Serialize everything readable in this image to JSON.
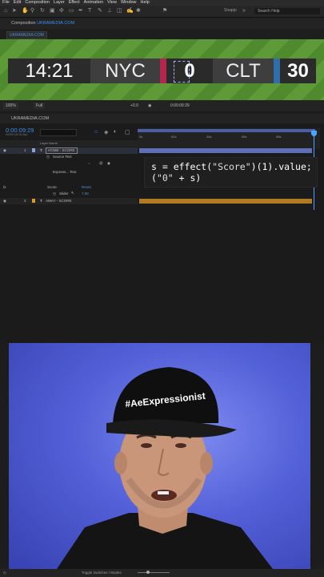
{
  "menu": [
    "File",
    "Edit",
    "Composition",
    "Layer",
    "Effect",
    "Animation",
    "View",
    "Window",
    "Help"
  ],
  "toolbar": {
    "snapping": "Snappi",
    "search_placeholder": "Search Help"
  },
  "composition_tab": {
    "prefix": "Composition",
    "name": "UKRAMEDIA.COM"
  },
  "comp_chip": "UKRAMEDIA.COM",
  "scoreboard": {
    "time": "14:21",
    "home_team": "NYC",
    "home_score": "0",
    "away_team": "CLT",
    "away_score": "30",
    "home_color": "#b5264e",
    "away_color": "#2f6ea8"
  },
  "viewer_controls": {
    "zoom": "100%",
    "resolution": "Full",
    "offset": "+0.0",
    "timecode": "0:00:09:29"
  },
  "timeline": {
    "tab": "UKRAMEDIA.COM",
    "timecode": "0:00:09:29",
    "timecode_sub": "00299 (30.00 fps)",
    "layer_name_header": "Layer Name",
    "ticks": [
      "0s",
      "02s",
      "04s",
      "06s",
      "08s"
    ],
    "layers": [
      {
        "num": "1",
        "name": "HOME - SCORE"
      },
      {
        "num": "2",
        "name": "AWAY - SCORE"
      }
    ],
    "source_text": "Source Text",
    "express_text": "Express... Text",
    "effect": "Score",
    "reset": "Reset",
    "slider": "Slider",
    "slider_value": "7.00"
  },
  "expression": {
    "line1_a": "s = effect(",
    "line1_str": "\"Score\"",
    "line1_b": ")(1).value;",
    "line2_a": "(",
    "line2_str": "\"0\"",
    "line2_b": " + s)"
  },
  "cap_text": "#AeExpressionist",
  "bottombar": {
    "toggle": "Toggle Switches / Modes"
  }
}
